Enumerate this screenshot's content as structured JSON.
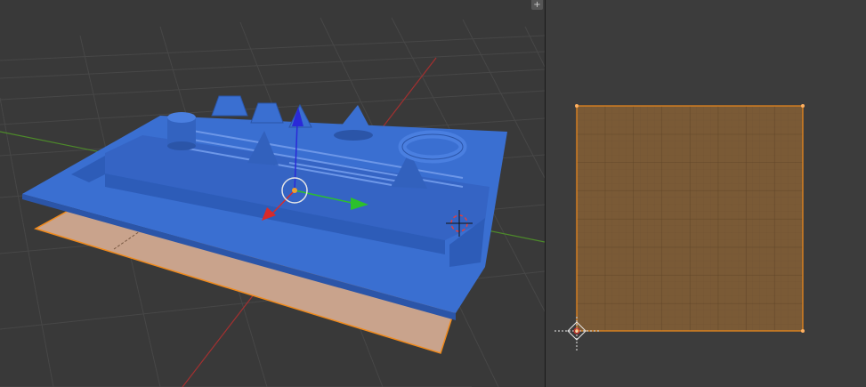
{
  "layout": {
    "left_panel": "3d-viewport",
    "right_panel": "uv-image-editor"
  },
  "corner_widgets": [
    {
      "icon": "plus-icon",
      "glyph": "+"
    },
    {
      "icon": "plus-icon",
      "glyph": "+"
    }
  ],
  "colors": {
    "background": "#393939",
    "grid_line": "#474747",
    "x_axis": "#a33030",
    "y_axis": "#4d8a2a",
    "mesh_blue": "#3a6fd1",
    "mesh_blue_dark": "#2b55a8",
    "selected_plane": "#c9a38c",
    "selection_orange": "#f08a1c",
    "uv_fill": "#7a5a36",
    "uv_grid": "#6a4d2c",
    "gizmo_z": "#2a2ad8",
    "gizmo_y": "#2cc02c",
    "gizmo_x": "#d82a2a"
  }
}
